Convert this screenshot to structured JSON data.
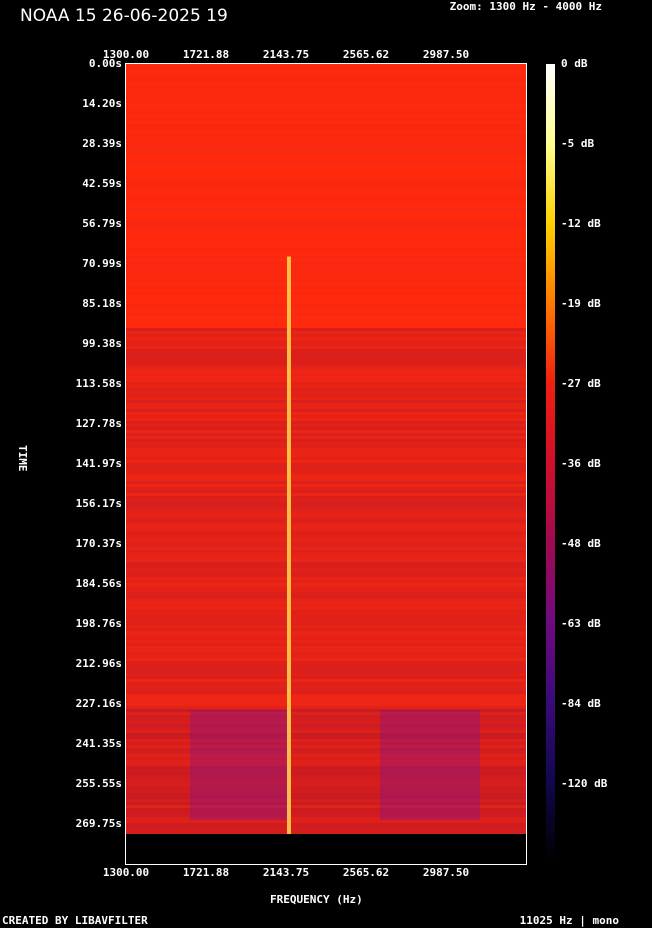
{
  "title": "NOAA 15 26-06-2025 19",
  "zoom_text": "Zoom: 1300 Hz - 4000 Hz",
  "created_text": "CREATED BY LIBAVFILTER",
  "rate_text": "11025 Hz | mono",
  "chart_data": {
    "type": "heatmap",
    "xlabel": "FREQUENCY (Hz)",
    "ylabel": "TIME",
    "x_ticks": [
      "1300.00",
      "1721.88",
      "2143.75",
      "2565.62",
      "2987.50"
    ],
    "y_ticks": [
      "0.00s",
      "14.20s",
      "28.39s",
      "42.59s",
      "56.79s",
      "70.99s",
      "85.18s",
      "99.38s",
      "113.58s",
      "127.78s",
      "141.97s",
      "156.17s",
      "170.37s",
      "184.56s",
      "198.76s",
      "212.96s",
      "227.16s",
      "241.35s",
      "255.55s",
      "269.75s"
    ],
    "xlim": [
      1300,
      4000
    ],
    "colorbar_ticks": [
      "0 dB",
      "-5 dB",
      "-12 dB",
      "-19 dB",
      "-27 dB",
      "-36 dB",
      "-48 dB",
      "-63 dB",
      "-84 dB",
      "-120 dB"
    ],
    "signal_line_hz": 2400,
    "signal_start_s": 70.99,
    "colors": {
      "background": "#ff2a0e",
      "signal": "#ffd24a",
      "cold": "#7a10a0"
    }
  }
}
